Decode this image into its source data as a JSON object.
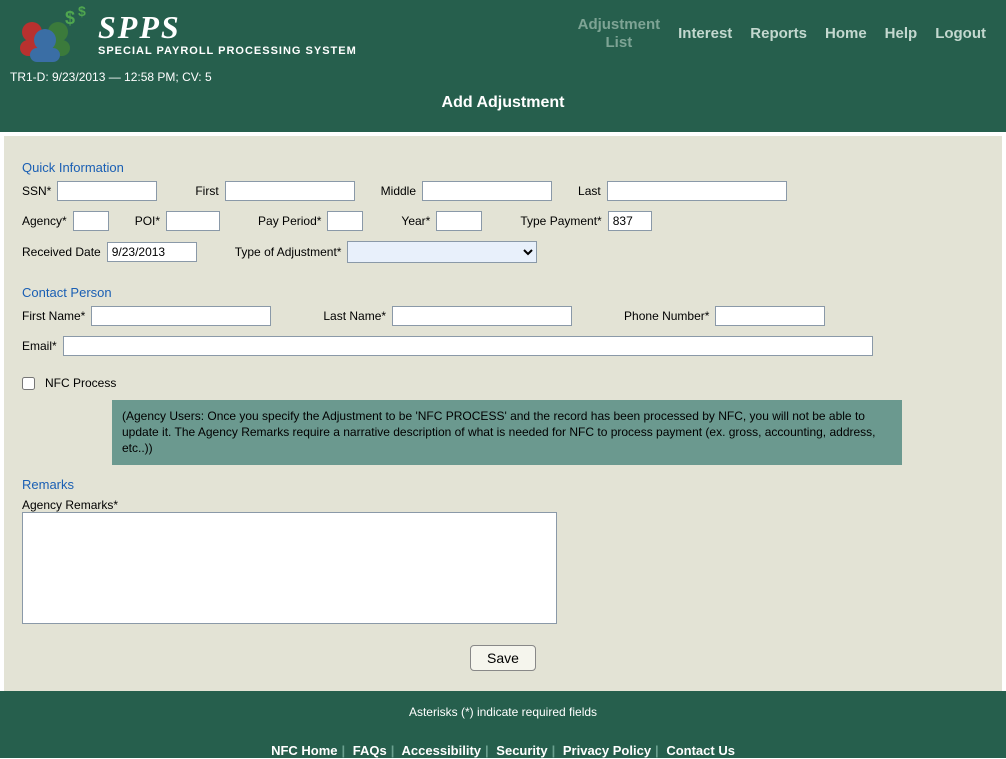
{
  "header": {
    "logo_main": "SPPS",
    "logo_sub": "SPECIAL PAYROLL PROCESSING SYSTEM",
    "nav": {
      "adjustment_list_line1": "Adjustment",
      "adjustment_list_line2": "List",
      "interest": "Interest",
      "reports": "Reports",
      "home": "Home",
      "help": "Help",
      "logout": "Logout"
    },
    "status": "TR1-D: 9/23/2013 — 12:58 PM; CV: 5",
    "page_title": "Add Adjustment"
  },
  "sections": {
    "quick_info": "Quick Information",
    "contact_person": "Contact Person",
    "remarks": "Remarks"
  },
  "labels": {
    "ssn": "SSN*",
    "first": "First",
    "middle": "Middle",
    "last": "Last",
    "agency": "Agency*",
    "poi": "POI*",
    "pay_period": "Pay Period*",
    "year": "Year*",
    "type_payment": "Type Payment*",
    "received_date": "Received Date",
    "type_of_adjustment": "Type of Adjustment*",
    "first_name": "First Name*",
    "last_name": "Last Name*",
    "phone_number": "Phone Number*",
    "email": "Email*",
    "nfc_process": "NFC Process",
    "agency_remarks": "Agency Remarks*"
  },
  "values": {
    "ssn": "",
    "first": "",
    "middle": "",
    "last": "",
    "agency": "",
    "poi": "",
    "pay_period": "",
    "year": "",
    "type_payment": "837",
    "received_date": "9/23/2013",
    "type_of_adjustment": "",
    "first_name": "",
    "last_name": "",
    "phone_number": "",
    "email": "",
    "agency_remarks": ""
  },
  "nfc_note": "(Agency Users: Once you specify the Adjustment to be 'NFC PROCESS' and the record has been processed by NFC, you will not be able to update it. The Agency Remarks require a narrative description of what is needed for NFC to process payment (ex. gross, accounting, address, etc..))",
  "buttons": {
    "save": "Save"
  },
  "footer": {
    "required_note": "Asterisks (*) indicate required fields",
    "links": {
      "nfc_home": "NFC Home",
      "faqs": "FAQs",
      "accessibility": "Accessibility",
      "security": "Security",
      "privacy": "Privacy Policy",
      "contact": "Contact Us"
    }
  }
}
